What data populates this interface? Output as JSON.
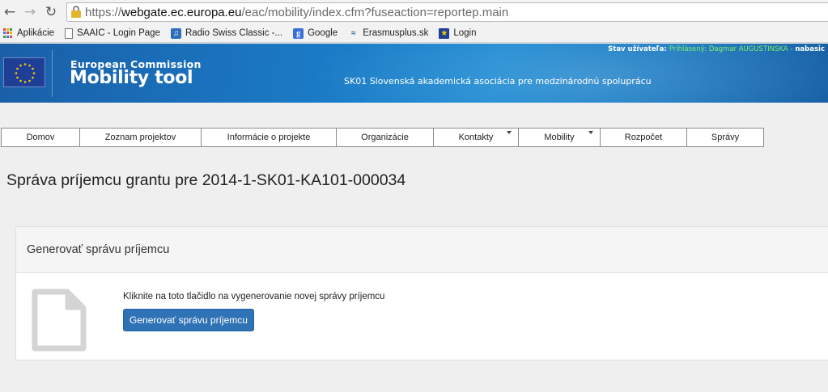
{
  "browser": {
    "url": {
      "scheme": "https://",
      "host": "webgate.ec.europa.eu",
      "path": "/eac/mobility/index.cfm?fuseaction=reportep.main"
    },
    "bookmarks": [
      {
        "label": "Aplikácie",
        "icon": "apps-grid-icon"
      },
      {
        "label": "SAAIC - Login Page",
        "icon": "page-icon"
      },
      {
        "label": "Radio Swiss Classic -...",
        "icon": "radio-icon"
      },
      {
        "label": "Google",
        "icon": "google-icon"
      },
      {
        "label": "Erasmusplus.sk",
        "icon": "erasmus-icon"
      },
      {
        "label": "Login",
        "icon": "eu-flag-icon"
      }
    ]
  },
  "header": {
    "ec_label": "European Commission",
    "app_name": "Mobility tool",
    "organization": "SK01 Slovenská akademická asociácia pre medzinárodnú spoluprácu",
    "user_status": {
      "prefix": "Stav užívateľa:",
      "logged_in": "Prihlásený:",
      "user_name": "Dagmar AUGUSTINSKA -",
      "role": "nabasic"
    }
  },
  "menu": {
    "items": [
      {
        "label": "Domov",
        "dropdown": false
      },
      {
        "label": "Zoznam projektov",
        "dropdown": false
      },
      {
        "label": "Informácie o projekte",
        "dropdown": false
      },
      {
        "label": "Organizácie",
        "dropdown": false
      },
      {
        "label": "Kontakty",
        "dropdown": true
      },
      {
        "label": "Mobility",
        "dropdown": true
      },
      {
        "label": "Rozpočet",
        "dropdown": false
      },
      {
        "label": "Správy",
        "dropdown": false
      }
    ]
  },
  "page": {
    "title": "Správa príjemcu grantu pre 2014-1-SK01-KA101-000034"
  },
  "panel": {
    "heading": "Generovať správu príjemcu",
    "instruction": "Kliknite na toto tlačidlo na vygenerovanie novej správy príjemcu",
    "button_label": "Generovať správu príjemcu"
  },
  "colors": {
    "banner_blue": "#1a78c3",
    "button_blue": "#2f72b5",
    "status_green": "#7ff06a"
  }
}
